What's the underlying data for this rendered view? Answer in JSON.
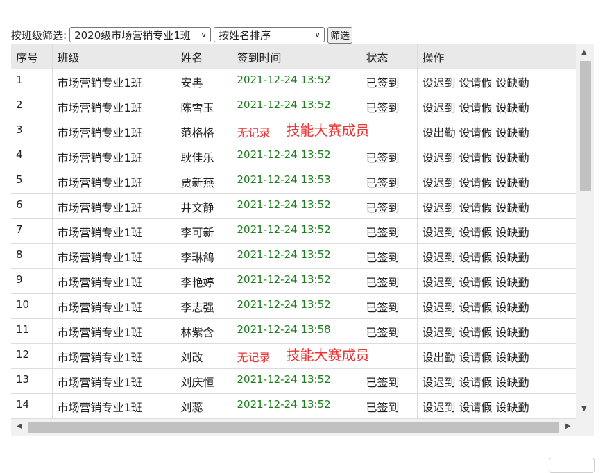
{
  "filter": {
    "label": "按班级筛选:",
    "class_selected": "2020级市场营销专业1班",
    "sort_selected": "按姓名排序",
    "button": "筛选"
  },
  "table": {
    "headers": [
      "序号",
      "班级",
      "姓名",
      "签到时间",
      "状态",
      "操作"
    ],
    "rows": [
      {
        "num": "1",
        "cls": "市场营销专业1班",
        "name": "安冉",
        "time": "2021-12-24 13:52",
        "status": "已签到",
        "op1": "设迟到",
        "op2": "设请假",
        "op3": "设缺勤",
        "note": ""
      },
      {
        "num": "2",
        "cls": "市场营销专业1班",
        "name": "陈雪玉",
        "time": "2021-12-24 13:52",
        "status": "已签到",
        "op1": "设迟到",
        "op2": "设请假",
        "op3": "设缺勤",
        "note": ""
      },
      {
        "num": "3",
        "cls": "市场营销专业1班",
        "name": "范格格",
        "time": "无记录",
        "status": "",
        "op1": "设出勤",
        "op2": "设请假",
        "op3": "设缺勤",
        "note": "技能大赛成员"
      },
      {
        "num": "4",
        "cls": "市场营销专业1班",
        "name": "耿佳乐",
        "time": "2021-12-24 13:52",
        "status": "已签到",
        "op1": "设迟到",
        "op2": "设请假",
        "op3": "设缺勤",
        "note": ""
      },
      {
        "num": "5",
        "cls": "市场营销专业1班",
        "name": "贾新燕",
        "time": "2021-12-24 13:53",
        "status": "已签到",
        "op1": "设迟到",
        "op2": "设请假",
        "op3": "设缺勤",
        "note": ""
      },
      {
        "num": "6",
        "cls": "市场营销专业1班",
        "name": "井文静",
        "time": "2021-12-24 13:52",
        "status": "已签到",
        "op1": "设迟到",
        "op2": "设请假",
        "op3": "设缺勤",
        "note": ""
      },
      {
        "num": "7",
        "cls": "市场营销专业1班",
        "name": "李可新",
        "time": "2021-12-24 13:52",
        "status": "已签到",
        "op1": "设迟到",
        "op2": "设请假",
        "op3": "设缺勤",
        "note": ""
      },
      {
        "num": "8",
        "cls": "市场营销专业1班",
        "name": "李琳鸽",
        "time": "2021-12-24 13:52",
        "status": "已签到",
        "op1": "设迟到",
        "op2": "设请假",
        "op3": "设缺勤",
        "note": ""
      },
      {
        "num": "9",
        "cls": "市场营销专业1班",
        "name": "李艳婷",
        "time": "2021-12-24 13:52",
        "status": "已签到",
        "op1": "设迟到",
        "op2": "设请假",
        "op3": "设缺勤",
        "note": ""
      },
      {
        "num": "10",
        "cls": "市场营销专业1班",
        "name": "李志强",
        "time": "2021-12-24 13:52",
        "status": "已签到",
        "op1": "设迟到",
        "op2": "设请假",
        "op3": "设缺勤",
        "note": ""
      },
      {
        "num": "11",
        "cls": "市场营销专业1班",
        "name": "林紫含",
        "time": "2021-12-24 13:58",
        "status": "已签到",
        "op1": "设迟到",
        "op2": "设请假",
        "op3": "设缺勤",
        "note": ""
      },
      {
        "num": "12",
        "cls": "市场营销专业1班",
        "name": "刘改",
        "time": "无记录",
        "status": "",
        "op1": "设出勤",
        "op2": "设请假",
        "op3": "设缺勤",
        "note": "技能大赛成员"
      },
      {
        "num": "13",
        "cls": "市场营销专业1班",
        "name": "刘庆恒",
        "time": "2021-12-24 13:52",
        "status": "已签到",
        "op1": "设迟到",
        "op2": "设请假",
        "op3": "设缺勤",
        "note": ""
      },
      {
        "num": "14",
        "cls": "市场营销专业1班",
        "name": "刘蕊",
        "time": "2021-12-24 13:52",
        "status": "已签到",
        "op1": "设迟到",
        "op2": "设请假",
        "op3": "设缺勤",
        "note": ""
      }
    ]
  },
  "colors": {
    "time_ok": "#1a7f1a",
    "no_record": "#e33",
    "header_bg": "#e9e9e9",
    "scroll_thumb": "#c1c1c1"
  },
  "icons": {
    "up_arrow": "scroll-up-arrow-icon",
    "down_arrow": "scroll-down-arrow-icon",
    "left_arrow": "scroll-left-arrow-icon",
    "right_arrow": "scroll-right-arrow-icon",
    "chevron": "chevron-down-icon"
  }
}
